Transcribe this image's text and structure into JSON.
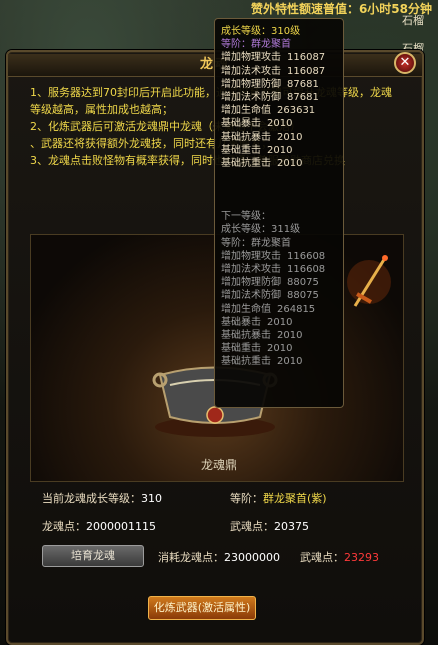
{
  "top_banner": "赞外特性额速普值：6小时58分钟",
  "side_labels": [
    "石榴",
    "石榴"
  ],
  "panel": {
    "title": "龙魂",
    "close_icon": "close-icon",
    "description": [
      "1、服务器达到70封印后开启此功能，通过培育龙魂可提升龙魂等级，龙魂等级越高，属性加成也越高；",
      "2、化炼武器后可激活龙魂鼎中龙魂（未激活不会激活）",
      "、武器还将获得额外龙魂技，同时还有几率触发；",
      "3、龙魂点击败怪物有概率获得，同时也可通过跨服武勋商店兑换"
    ],
    "cauldron_label": "龙魂鼎",
    "stats": {
      "current_level_label": "当前龙魂成长等级：",
      "current_level_value": "310",
      "rank_label": "等阶：",
      "rank_value": "群龙聚首(紫)",
      "dragon_points_label": "龙魂点：",
      "dragon_points_value": "2000001115",
      "martial_points_label": "武魂点：",
      "martial_points_value": "20375",
      "consume_dragon_label": "消耗龙魂点：",
      "consume_dragon_value": "23000000",
      "consume_martial_label": "武魂点：",
      "consume_martial_value": "23293"
    },
    "buttons": {
      "cultivate": "培育龙魂",
      "refine": "化炼武器(激活属性)"
    }
  },
  "tooltip": {
    "current": {
      "level": "成长等级：310级",
      "rank": "等阶：群龙聚首",
      "attrs": [
        {
          "label": "增加物理攻击",
          "value": "116087"
        },
        {
          "label": "增加法术攻击",
          "value": "116087"
        },
        {
          "label": "增加物理防御",
          "value": "87681"
        },
        {
          "label": "增加法术防御",
          "value": "87681"
        },
        {
          "label": "增加生命值",
          "value": "263631"
        },
        {
          "label": "基础暴击",
          "value": "2010"
        },
        {
          "label": "基础抗暴击",
          "value": "2010"
        },
        {
          "label": "基础重击",
          "value": "2010"
        },
        {
          "label": "基础抗重击",
          "value": "2010"
        }
      ]
    },
    "next": {
      "header": "下一等级：",
      "level": "成长等级：311级",
      "rank": "等阶：群龙聚首",
      "attrs": [
        {
          "label": "增加物理攻击",
          "value": "116608"
        },
        {
          "label": "增加法术攻击",
          "value": "116608"
        },
        {
          "label": "增加物理防御",
          "value": "88075"
        },
        {
          "label": "增加法术防御",
          "value": "88075"
        },
        {
          "label": "增加生命值",
          "value": "264815"
        },
        {
          "label": "基础暴击",
          "value": "2010"
        },
        {
          "label": "基础抗暴击",
          "value": "2010"
        },
        {
          "label": "基础重击",
          "value": "2010"
        },
        {
          "label": "基础抗重击",
          "value": "2010"
        }
      ]
    }
  }
}
